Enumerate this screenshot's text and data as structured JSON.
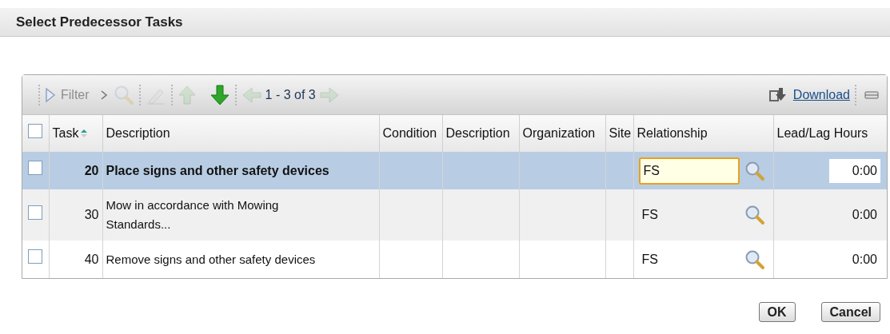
{
  "window": {
    "title": "Select Predecessor Tasks"
  },
  "toolbar": {
    "filter": {
      "label": "Filter",
      "disabled": true
    },
    "pager": "1 - 3 of 3",
    "download": "Download"
  },
  "table": {
    "columns": [
      {
        "label": "Task",
        "sorted": true
      },
      {
        "label": "Description",
        "sorted": false
      },
      {
        "label": "Condition",
        "sorted": false
      },
      {
        "label": "Description",
        "sorted": false
      },
      {
        "label": "Organization",
        "sorted": false
      },
      {
        "label": "Site",
        "sorted": false
      },
      {
        "label": "Relationship",
        "sorted": false
      },
      {
        "label": "Lead/Lag Hours",
        "sorted": false
      }
    ],
    "all_checked": false,
    "rows": [
      {
        "task": "20",
        "description": "Place signs and other safety devices",
        "relationship": "FS",
        "lead_lag": "0:00",
        "selected": true,
        "checked": false
      },
      {
        "task": "30",
        "description": "Mow in accordance with Mowing Standards...",
        "relationship": "FS",
        "lead_lag": "0:00",
        "selected": false,
        "checked": false
      },
      {
        "task": "40",
        "description": "Remove signs and other safety devices",
        "relationship": "FS",
        "lead_lag": "0:00",
        "selected": false,
        "checked": false
      }
    ]
  },
  "buttons": [
    "OK",
    "Cancel"
  ]
}
